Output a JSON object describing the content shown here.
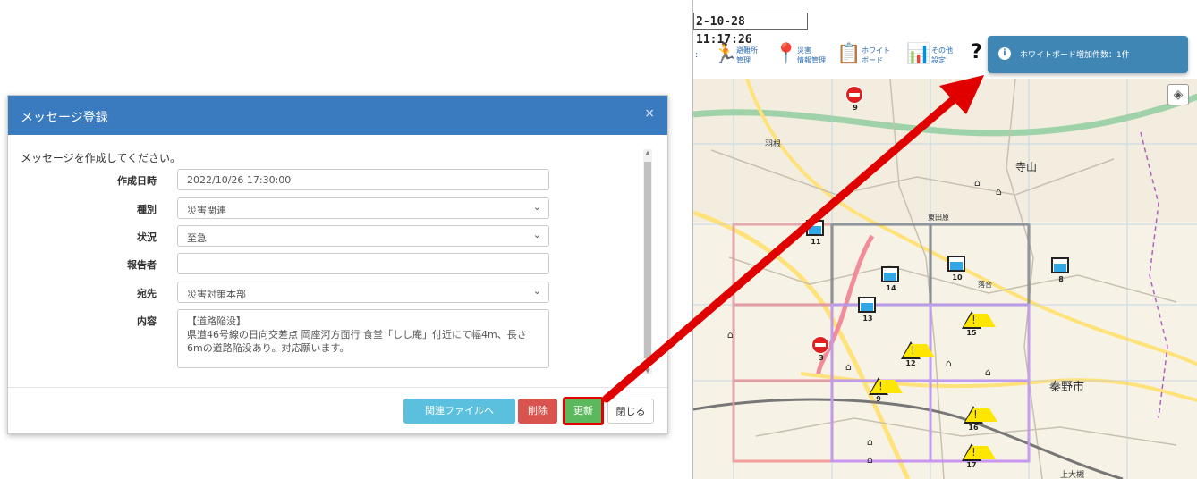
{
  "modal": {
    "title": "メッセージ登録",
    "close": "×",
    "intro": "メッセージを作成してください。",
    "fields": {
      "created_label": "作成日時",
      "created_value": "2022/10/26 17:30:00",
      "type_label": "種別",
      "type_value": "災害関連",
      "status_label": "状況",
      "status_value": "至急",
      "reporter_label": "報告者",
      "reporter_value": "",
      "to_label": "宛先",
      "to_value": "災害対策本部",
      "content_label": "内容",
      "content_line1": "【道路陥没】",
      "content_line2": "県道46号線の日向交差点 岡座河方面行 食堂「しし庵」付近にて幅4m、長さ",
      "content_line3": "6mの道路陥没あり。対応願います。"
    },
    "buttons": {
      "files": "関連ファイルへ",
      "delete": "削除",
      "update": "更新",
      "close": "閉じる"
    }
  },
  "app": {
    "datetime": "2-10-28 11:17:26",
    "toolbar": [
      {
        "label1": "避難所",
        "label2": "管理",
        "icon": "running-person-icon"
      },
      {
        "label1": "災害",
        "label2": "情報管理",
        "icon": "map-pin-icon"
      },
      {
        "label1": "ホワイト",
        "label2": "ボード",
        "icon": "whiteboard-icon"
      },
      {
        "label1": "その他",
        "label2": "設定",
        "icon": "chart-icon"
      }
    ],
    "help": "?",
    "notification": "ホワイトボード増加件数：1件",
    "map": {
      "labels": [
        "寺山",
        "羽根",
        "東田原",
        "秦野市",
        "上大槻",
        "落合"
      ],
      "markers": [
        {
          "type": "noentry",
          "num": "9"
        },
        {
          "type": "water",
          "num": "11"
        },
        {
          "type": "water",
          "num": "14"
        },
        {
          "type": "water",
          "num": "10"
        },
        {
          "type": "water",
          "num": "8"
        },
        {
          "type": "water",
          "num": "13"
        },
        {
          "type": "warn",
          "num": "15"
        },
        {
          "type": "warn",
          "num": "12"
        },
        {
          "type": "warn",
          "num": "9"
        },
        {
          "type": "warn",
          "num": "16"
        },
        {
          "type": "warn",
          "num": "17"
        },
        {
          "type": "noentry",
          "num": "3"
        }
      ]
    }
  },
  "colors": {
    "header": "#3a7bbf",
    "files_button": "#5bc0de",
    "delete_button": "#d9534f",
    "update_button": "#5cb85c",
    "highlight": "#e00000",
    "notification": "#3f86b5"
  }
}
